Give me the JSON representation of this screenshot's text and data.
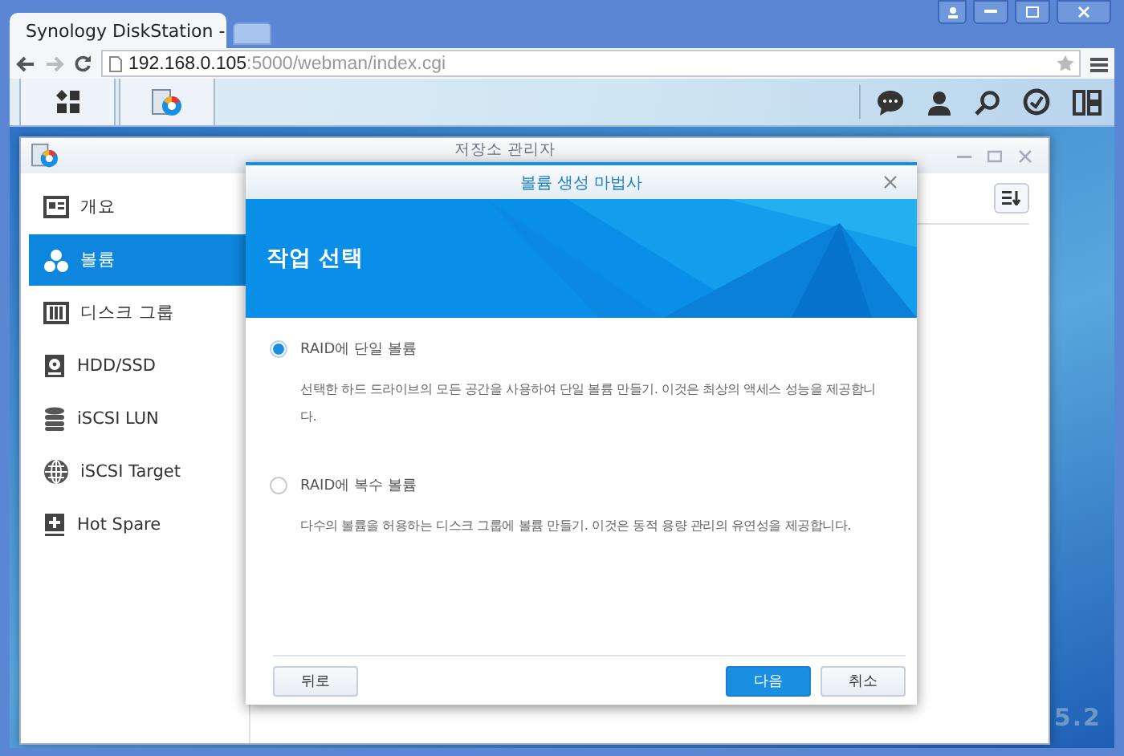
{
  "browser": {
    "tab_title": "Synology DiskStation -",
    "url_host": "192.168.0.105",
    "url_rest": ":5000/webman/index.cgi"
  },
  "window": {
    "title": "저장소 관리자",
    "sidebar": [
      {
        "label": "개요",
        "selected": false
      },
      {
        "label": "볼륨",
        "selected": true
      },
      {
        "label": "디스크 그룹",
        "selected": false
      },
      {
        "label": "HDD/SSD",
        "selected": false
      },
      {
        "label": "iSCSI LUN",
        "selected": false
      },
      {
        "label": "iSCSI Target",
        "selected": false
      },
      {
        "label": "Hot Spare",
        "selected": false
      }
    ]
  },
  "dialog": {
    "title": "볼륨 생성 마법사",
    "heading": "작업 선택",
    "options": [
      {
        "label": "RAID에 단일 볼륨",
        "description": "선택한 하드 드라이브의 모든 공간을 사용하여 단일 볼륨 만들기. 이것은 최상의 액세스 성능을 제공합니다.",
        "selected": true
      },
      {
        "label": "RAID에 복수 볼륨",
        "description": "다수의 볼륨을 허용하는 디스크 그룹에 볼륨 만들기. 이것은 동적 용량 관리의 유연성을 제공합니다.",
        "selected": false
      }
    ],
    "buttons": [
      {
        "label": "뒤로",
        "kind": "back"
      },
      {
        "label": "다음",
        "kind": "primary"
      },
      {
        "label": "취소",
        "kind": "normal"
      }
    ]
  },
  "desktop_text": "5.2"
}
